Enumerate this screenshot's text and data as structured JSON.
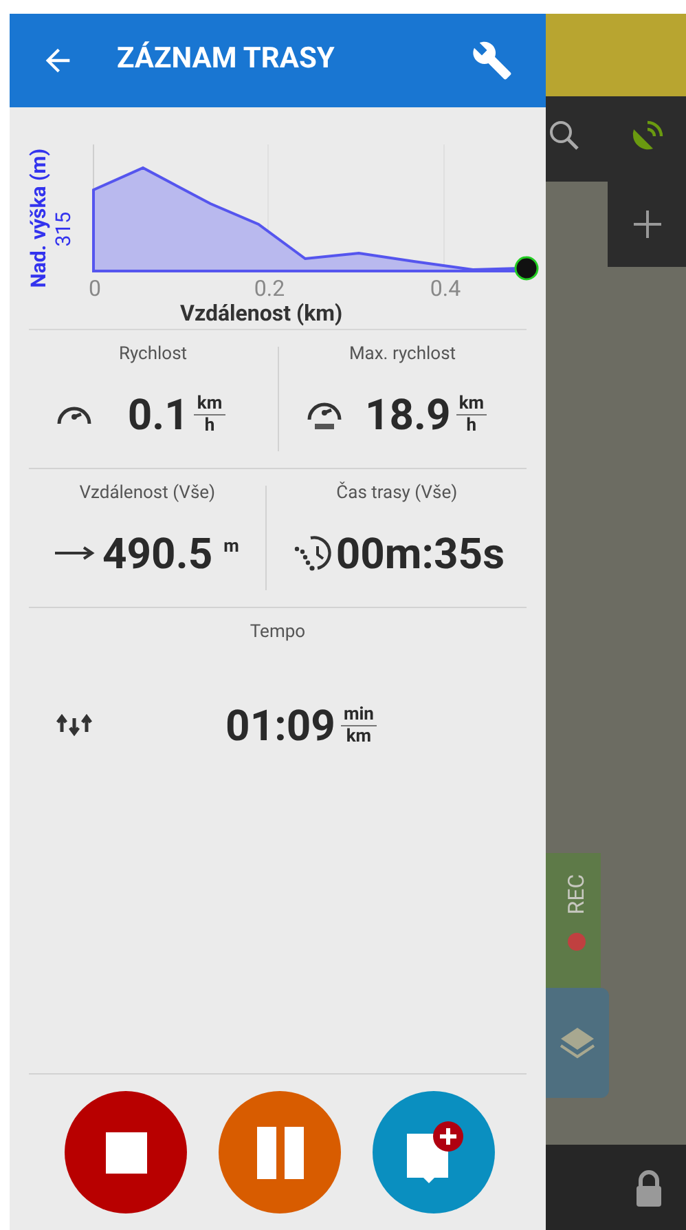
{
  "header": {
    "title": "ZÁZNAM TRASY"
  },
  "elevation_chart": {
    "ylabel": "Nad. výška (m)",
    "ytick": "315",
    "xticks": [
      "0",
      "0.2",
      "0.4"
    ],
    "xlabel": "Vzdálenost (km)"
  },
  "stats": [
    {
      "kind": "speed",
      "label": "Rychlost",
      "value": "0.1",
      "unit_top": "km",
      "unit_bottom": "h"
    },
    {
      "kind": "max-speed",
      "label": "Max. rychlost",
      "value": "18.9",
      "unit_top": "km",
      "unit_bottom": "h"
    },
    {
      "kind": "distance",
      "label": "Vzdálenost (Vše)",
      "value": "490.5",
      "unit": "m"
    },
    {
      "kind": "time",
      "label": "Čas trasy (Vše)",
      "value": "00m:35s"
    },
    {
      "kind": "pace",
      "label": "Tempo",
      "value": "01:09",
      "unit_top": "min",
      "unit_bottom": "km"
    }
  ],
  "controls": [
    {
      "kind": "stop"
    },
    {
      "kind": "pause"
    },
    {
      "kind": "add-point"
    }
  ],
  "map": {
    "rec_label": "REC"
  }
}
